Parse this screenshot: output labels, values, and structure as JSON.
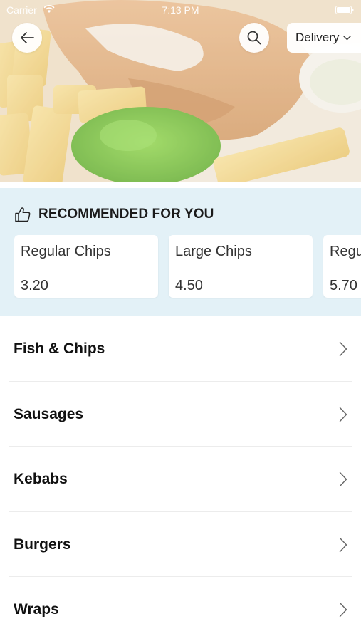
{
  "status_bar": {
    "carrier": "Carrier",
    "time": "7:13 PM"
  },
  "header": {
    "back_icon": "arrow-left-icon",
    "search_icon": "search-icon",
    "delivery": {
      "label": "Delivery",
      "icon": "chevron-down-icon"
    }
  },
  "recommended": {
    "title": "RECOMMENDED FOR YOU",
    "icon": "thumbs-up-icon",
    "items": [
      {
        "name": "Regular Chips",
        "price": "3.20"
      },
      {
        "name": "Large Chips",
        "price": "4.50"
      },
      {
        "name": "Regu",
        "price": "5.70"
      }
    ]
  },
  "categories": [
    {
      "label": "Fish & Chips"
    },
    {
      "label": "Sausages"
    },
    {
      "label": "Kebabs"
    },
    {
      "label": "Burgers"
    },
    {
      "label": "Wraps"
    }
  ],
  "colors": {
    "reco_background": "#e3f1f7",
    "divider": "#ececec"
  }
}
